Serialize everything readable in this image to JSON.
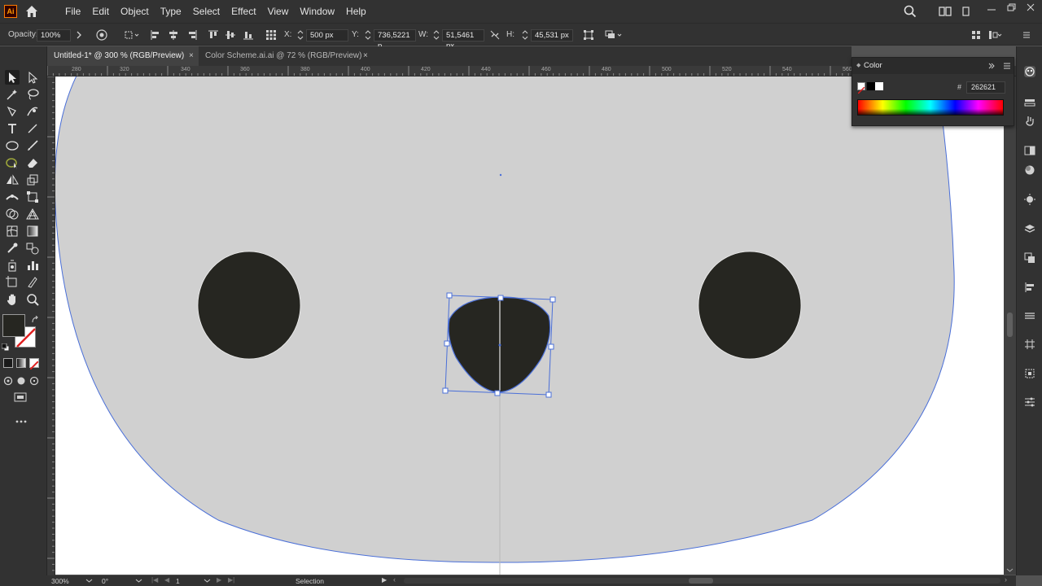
{
  "app": {
    "logo_text": "Ai",
    "menus": [
      "File",
      "Edit",
      "Object",
      "Type",
      "Select",
      "Effect",
      "View",
      "Window",
      "Help"
    ]
  },
  "control_bar": {
    "opacity_label": "Opacity:",
    "opacity_value": "100%",
    "x_label": "X:",
    "x_value": "500 px",
    "y_label": "Y:",
    "y_value": "736,5221 p",
    "w_label": "W:",
    "w_value": "51,5461 px",
    "h_label": "H:",
    "h_value": "45,531 px"
  },
  "tabs": [
    {
      "label": "Untitled-1* @ 300 % (RGB/Preview)",
      "active": true
    },
    {
      "label": "Color Scheme.ai.ai @ 72 % (RGB/Preview)",
      "active": false
    }
  ],
  "tab_close_glyph": "×",
  "ruler_top_labels": [
    "280",
    "320",
    "340",
    "360",
    "380",
    "400",
    "420",
    "440",
    "460",
    "480",
    "500",
    "520",
    "540",
    "560",
    "580",
    "600",
    "620",
    "640",
    "660"
  ],
  "color_panel": {
    "title": "Color",
    "hex_symbol": "#",
    "hex_value": "262621"
  },
  "status_bar": {
    "zoom": "300%",
    "rotation": "0°",
    "artboard_number": "1",
    "tool_name": "Selection"
  },
  "colors": {
    "ui_dark": "#323232",
    "face_fill": "#d0d0d0",
    "feature_fill": "#262621",
    "selection_blue": "#4a6fd8"
  },
  "icons": {
    "home": "home-icon",
    "search": "search-icon",
    "workspace": "workspace-icon",
    "fill_swatch": "fill-swatch",
    "stroke_swatch": "stroke-swatch"
  }
}
